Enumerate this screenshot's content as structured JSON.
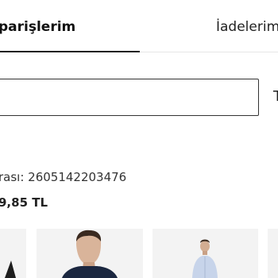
{
  "tabs": {
    "active_label": "parişlerim",
    "inactive_label": "İadelerim"
  },
  "search": {
    "value": "",
    "side_text": "T"
  },
  "order": {
    "number_text": "rası: 2605142203476",
    "price_text": "9,85 TL"
  },
  "products": [
    {
      "name": "product-1"
    },
    {
      "name": "product-2"
    },
    {
      "name": "product-3"
    },
    {
      "name": "product-4"
    }
  ],
  "colors": {
    "accent": "#222222",
    "thumb_bg": "#f3f3f3"
  }
}
